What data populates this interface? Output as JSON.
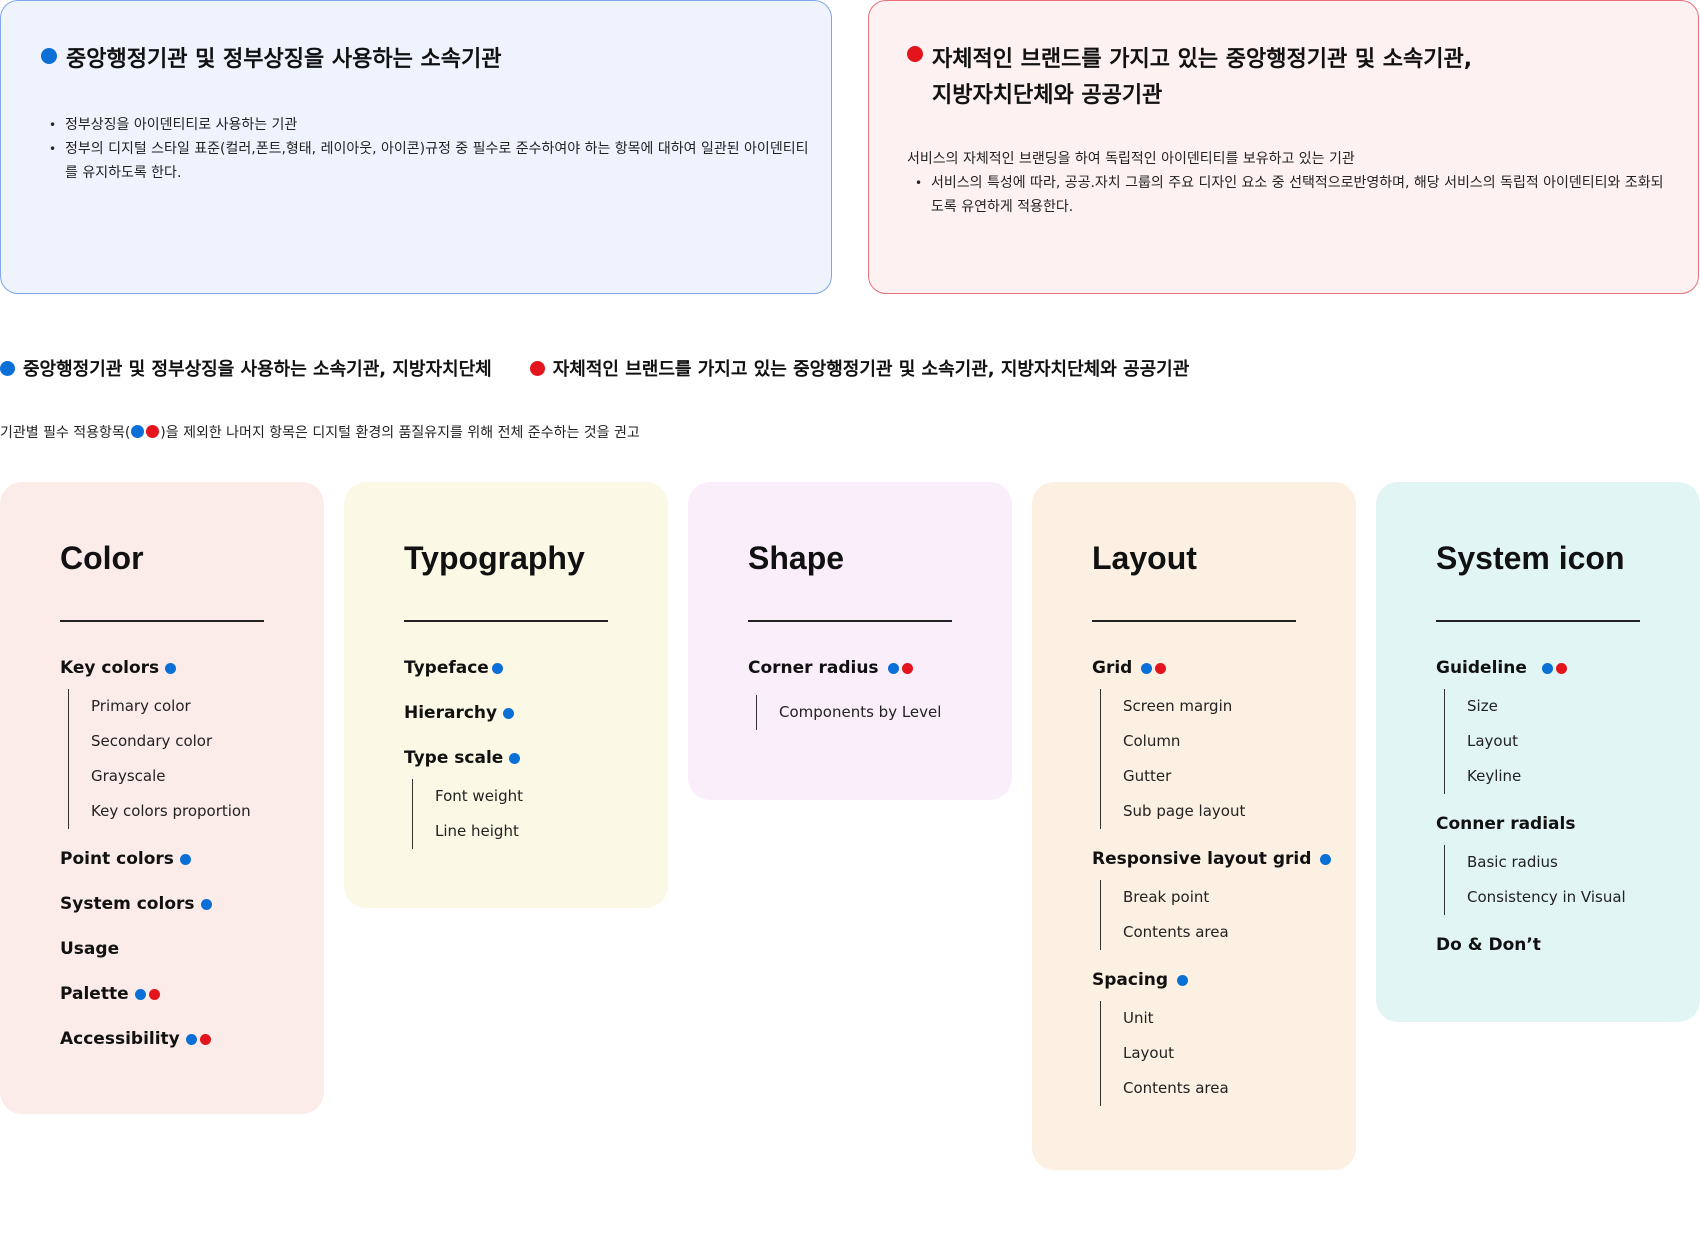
{
  "box_blue": {
    "title": "중앙행정기관 및 정부상징을 사용하는 소속기관",
    "bullets": [
      "정부상징을 아이덴티티로 사용하는 기관",
      "정부의 디지털 스타일 표준(컬러,폰트,형태, 레이아웃, 아이콘)규정 중 필수로 준수하여야 하는 항목에 대하여 일관된 아이덴티티를 유지하도록 한다."
    ],
    "color": "#0a6fd6"
  },
  "box_red": {
    "title_line1": "자체적인 브랜드를 가지고 있는 중앙행정기관 및 소속기관,",
    "title_line2": "지방자치단체와 공공기관",
    "description": "서비스의 자체적인 브랜딩을 하여 독립적인 아이덴티티를 보유하고 있는 기관",
    "bullets": [
      "서비스의 특성에 따라, 공공.자치 그룹의 주요 디자인 요소 중 선택적으로반영하며, 해당 서비스의 독립적 아이덴티티와 조화되도록 유연하게 적용한다."
    ],
    "color": "#e3141b"
  },
  "legend": {
    "blue_label": "중앙행정기관 및  정부상징을 사용하는 소속기관, 지방자치단체",
    "red_label": "자체적인 브랜드를 가지고 있는 중앙행정기관 및 소속기관, 지방자치단체와 공공기관"
  },
  "note": {
    "prefix": "기관별 필수 적용항목(",
    "suffix": ")을 제외한 나머지 항목은 디지털 환경의 품질유지를 위해 전체 준수하는 것을 권고"
  },
  "cards": {
    "color": {
      "title": "Color",
      "sections": [
        {
          "label": "Key colors",
          "items": [
            "Primary color",
            "Secondary color",
            "Grayscale",
            "Key colors proportion"
          ]
        },
        {
          "label": "Point colors"
        },
        {
          "label": "System colors"
        },
        {
          "label": "Usage"
        },
        {
          "label": "Palette"
        },
        {
          "label": "Accessibility"
        }
      ]
    },
    "typography": {
      "title": "Typography",
      "sections": [
        {
          "label": "Typeface"
        },
        {
          "label": "Hierarchy"
        },
        {
          "label": "Type scale",
          "items": [
            "Font weight",
            "Line height"
          ]
        }
      ]
    },
    "shape": {
      "title": "Shape",
      "sections": [
        {
          "label": "Corner radius",
          "items": [
            "Components by Level"
          ]
        }
      ]
    },
    "layout": {
      "title": "Layout",
      "sections": [
        {
          "label": "Grid",
          "items": [
            "Screen margin",
            "Column",
            "Gutter",
            "Sub page layout"
          ]
        },
        {
          "label": "Responsive layout grid",
          "items": [
            "Break point",
            "Contents area"
          ]
        },
        {
          "label": "Spacing",
          "items": [
            "Unit",
            "Layout",
            "Contents area"
          ]
        }
      ]
    },
    "system_icon": {
      "title": "System icon",
      "sections": [
        {
          "label": "Guideline",
          "items": [
            "Size",
            "Layout",
            "Keyline"
          ]
        },
        {
          "label": "Conner radials",
          "items": [
            "Basic radius",
            "Consistency in Visual"
          ]
        },
        {
          "label": "Do & Don’t"
        }
      ]
    }
  },
  "colors": {
    "blue_dot": "#0a6fd6",
    "red_dot": "#e3141b",
    "card_color_bg": "#fbecea",
    "card_typography_bg": "#fbf9e5",
    "card_shape_bg": "#fbeefb",
    "card_layout_bg": "#fcf0e2",
    "card_system_icon_bg": "#e0f5f4"
  }
}
